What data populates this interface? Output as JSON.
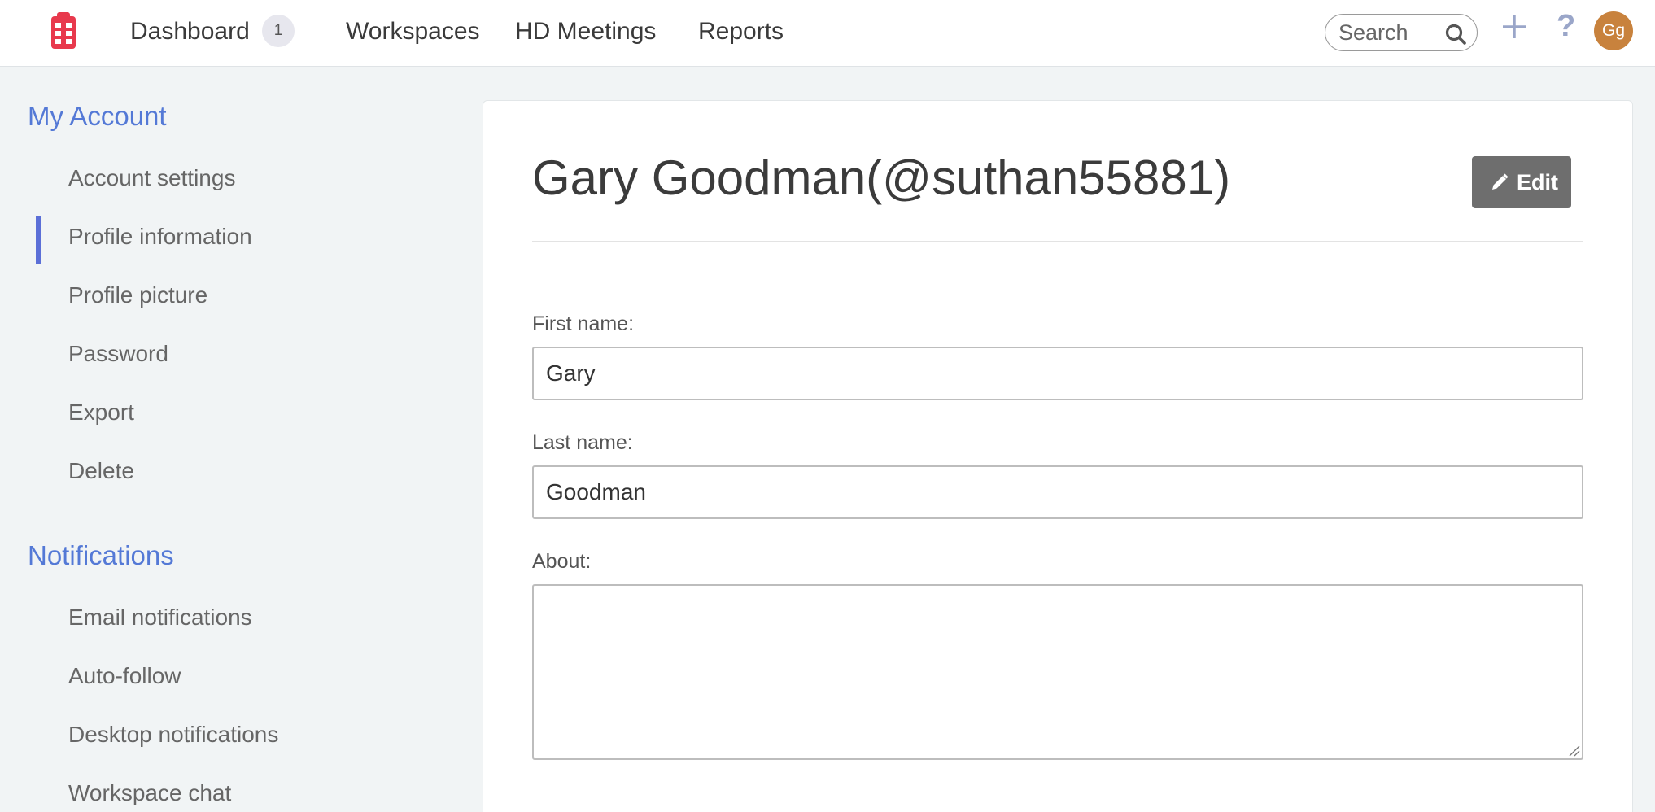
{
  "nav": {
    "dashboard": "Dashboard",
    "dashboard_badge": "1",
    "workspaces": "Workspaces",
    "hd_meetings": "HD Meetings",
    "reports": "Reports",
    "search_placeholder": "Search",
    "help": "?",
    "avatar_initials": "Gg"
  },
  "sidebar": {
    "my_account": {
      "title": "My Account",
      "items": [
        "Account settings",
        "Profile information",
        "Profile picture",
        "Password",
        "Export",
        "Delete"
      ]
    },
    "active_item": "Profile information",
    "notifications": {
      "title": "Notifications",
      "items": [
        "Email notifications",
        "Auto-follow",
        "Desktop notifications",
        "Workspace chat"
      ]
    }
  },
  "profile": {
    "title": "Gary Goodman(@suthan55881)",
    "edit_label": "Edit",
    "first_name_label": "First name:",
    "first_name_value": "Gary",
    "last_name_label": "Last name:",
    "last_name_value": "Goodman",
    "about_label": "About:",
    "about_value": ""
  },
  "colors": {
    "accent": "#5479d6",
    "active_bar": "#5b6fd7",
    "logo": "#e8394d",
    "avatar": "#c8823d",
    "edit_button": "#6e6e6e"
  },
  "icons": [
    "logo-icon",
    "search-icon",
    "plus-icon",
    "help-icon",
    "pencil-icon",
    "resize-handle-icon"
  ]
}
